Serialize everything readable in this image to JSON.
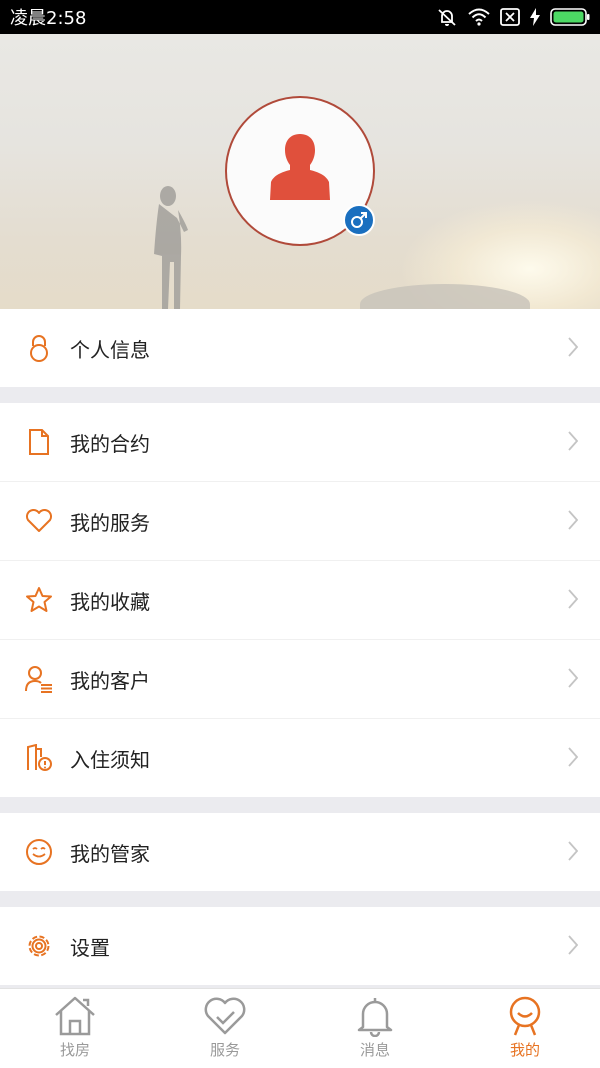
{
  "status_bar": {
    "time": "凌晨2:58"
  },
  "menu": {
    "groups": [
      {
        "items": [
          {
            "label": "个人信息",
            "icon": "lock-icon"
          }
        ]
      },
      {
        "items": [
          {
            "label": "我的合约",
            "icon": "document-icon"
          },
          {
            "label": "我的服务",
            "icon": "heart-icon"
          },
          {
            "label": "我的收藏",
            "icon": "star-icon"
          },
          {
            "label": "我的客户",
            "icon": "customer-list-icon"
          },
          {
            "label": "入住须知",
            "icon": "checkin-notice-icon"
          }
        ]
      },
      {
        "items": [
          {
            "label": "我的管家",
            "icon": "smile-icon"
          }
        ]
      },
      {
        "items": [
          {
            "label": "设置",
            "icon": "gear-icon"
          }
        ]
      }
    ]
  },
  "tabs": [
    {
      "label": "找房",
      "icon": "house-icon",
      "active": false
    },
    {
      "label": "服务",
      "icon": "heart-tab-icon",
      "active": false
    },
    {
      "label": "消息",
      "icon": "bell-icon",
      "active": false
    },
    {
      "label": "我的",
      "icon": "smiley-face-icon",
      "active": true
    }
  ],
  "colors": {
    "accent": "#e77322",
    "avatar_red": "#e0503c",
    "gender_blue": "#1a6fbf"
  }
}
